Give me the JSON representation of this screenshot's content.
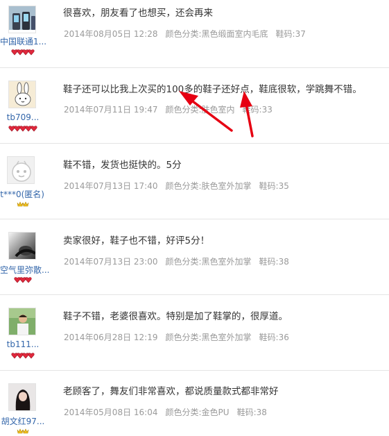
{
  "reviews": [
    {
      "user": "中国联通1...",
      "badge_type": "red",
      "badge_count": 4,
      "comment": "很喜欢，朋友看了也想买，还会再来",
      "date": "2014年08月05日 12:28",
      "color": "颜色分类:黑色缎面室内毛底",
      "size": "鞋码:37",
      "avatar_icon": "phones-avatar-icon"
    },
    {
      "user": "tb709...",
      "badge_type": "red",
      "badge_count": 5,
      "comment": "鞋子还可以比我上次买的100多的鞋子还好点，鞋底很软，学跳舞不错。",
      "date": "2014年07月11日 19:47",
      "color": "颜色分类:肤色室内",
      "size": "鞋码:33",
      "avatar_icon": "bunny-avatar-icon"
    },
    {
      "user": "t***0(匿名)",
      "badge_type": "gold",
      "badge_count": 2,
      "comment": "鞋不错，发货也挺快的。5分",
      "date": "2014年07月13日 17:40",
      "color": "颜色分类:肤色室外加掌",
      "size": "鞋码:35",
      "avatar_icon": "default-avatar-icon"
    },
    {
      "user": "空气里弥散...",
      "badge_type": "red",
      "badge_count": 3,
      "comment": "卖家很好，鞋子也不错，好评5分！",
      "date": "2014年07月13日 23:00",
      "color": "颜色分类:黑色室外加掌",
      "size": "鞋码:38",
      "avatar_icon": "portrait-avatar-icon"
    },
    {
      "user": "tb111...",
      "badge_type": "red",
      "badge_count": 4,
      "comment": "鞋子不错，老婆很喜欢。特别是加了鞋掌的，很厚道。",
      "date": "2014年06月28日 12:19",
      "color": "颜色分类:黑色室外加掌",
      "size": "鞋码:36",
      "avatar_icon": "man-avatar-icon"
    },
    {
      "user": "胡文红97...",
      "badge_type": "gold",
      "badge_count": 2,
      "comment": "老顾客了，舞友们非常喜欢，都说质量款式都非常好",
      "date": "2014年05月08日 16:04",
      "color": "颜色分类:金色PU",
      "size": "鞋码:38",
      "avatar_icon": "woman-avatar-icon"
    }
  ],
  "colors": {
    "username": "#3366aa",
    "comment": "#333333",
    "meta": "#9a9a9a",
    "separator": "#e4e4e4",
    "arrow": "#e60012",
    "badge_red": "#e0283c",
    "badge_gold": "#f0c020"
  }
}
